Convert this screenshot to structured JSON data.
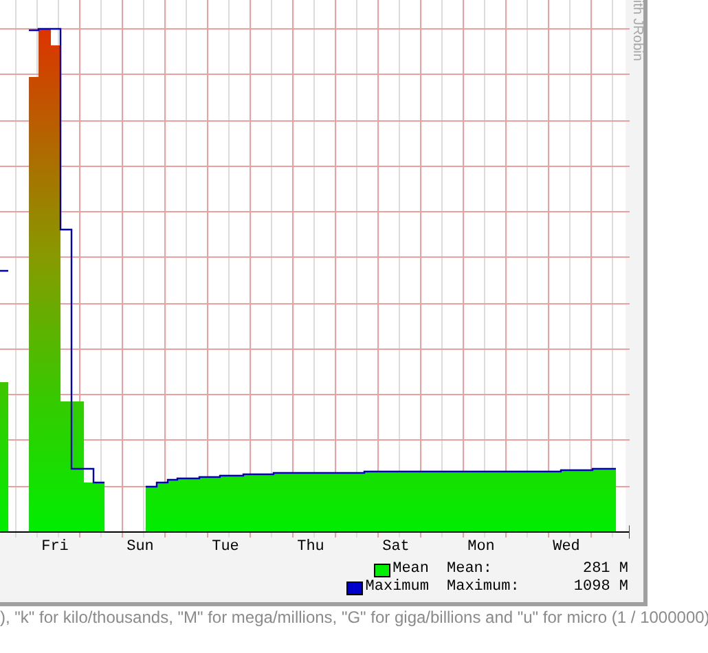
{
  "graph": {
    "credit": "ith JRobin",
    "x_labels": [
      "Fri",
      "Sun",
      "Tue",
      "Thu",
      "Sat",
      "Mon",
      "Wed"
    ],
    "legend": [
      {
        "name": "Mean",
        "label": "Mean:",
        "value": "281 M",
        "color": "#00ee00"
      },
      {
        "name": "Maximum",
        "label": "Maximum:",
        "value": "1098 M",
        "color": "#0000cc"
      }
    ]
  },
  "footer": "), \"k\" for kilo/thousands, \"M\" for mega/millions, \"G\" for giga/billions and \"u\" for micro (1 / 1000000)"
}
